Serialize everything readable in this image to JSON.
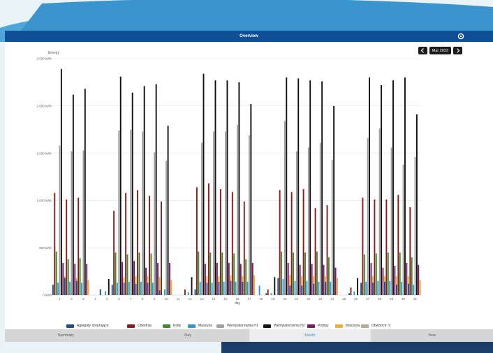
{
  "window": {
    "title": "Overview"
  },
  "nav": {
    "period": "Mar 2023"
  },
  "chart_data": {
    "type": "bar",
    "ylabel": "Energy",
    "xlabel": "day",
    "ylim": [
      0,
      2500
    ],
    "yticks": [
      0,
      500,
      1000,
      1500,
      2000,
      2500
    ],
    "ytick_labels": [
      "0 kWh",
      "500 kWh",
      "1,000 kWh",
      "1,500 kWh",
      "2,000 kWh",
      "2,500 kWh"
    ],
    "categories": [
      "1",
      "2",
      "3",
      "4",
      "5",
      "6",
      "7",
      "8",
      "9",
      "10",
      "11",
      "12",
      "13",
      "14",
      "15",
      "16",
      "17",
      "18",
      "19",
      "20",
      "21",
      "22",
      "23",
      "24",
      "25",
      "26",
      "27",
      "28",
      "29",
      "30",
      "31"
    ],
    "series": [
      {
        "name": "Agregaty sprężające",
        "color": "#1f4f86",
        "values": [
          110,
          180,
          150,
          0,
          60,
          110,
          130,
          120,
          130,
          50,
          0,
          0,
          60,
          130,
          140,
          150,
          140,
          0,
          20,
          180,
          100,
          100,
          120,
          140,
          0,
          20,
          130,
          130,
          140,
          110,
          120
        ]
      },
      {
        "name": "Chłodnia",
        "color": "#8b1a1a",
        "values": [
          1080,
          1010,
          1030,
          0,
          0,
          890,
          1080,
          1110,
          1050,
          990,
          0,
          60,
          1140,
          1180,
          1120,
          1090,
          990,
          0,
          60,
          1110,
          1090,
          1120,
          920,
          950,
          0,
          80,
          1030,
          1010,
          1010,
          1060,
          930
        ]
      },
      {
        "name": "Kotły",
        "color": "#3f8a2e",
        "values": [
          460,
          380,
          390,
          0,
          0,
          450,
          430,
          450,
          440,
          0,
          0,
          0,
          460,
          450,
          450,
          440,
          380,
          0,
          0,
          460,
          450,
          450,
          460,
          400,
          0,
          0,
          430,
          440,
          450,
          450,
          400
        ]
      },
      {
        "name": "Maszyna",
        "color": "#2c9ad6",
        "values": [
          130,
          140,
          130,
          0,
          40,
          130,
          140,
          140,
          130,
          60,
          0,
          30,
          140,
          130,
          140,
          140,
          140,
          100,
          20,
          170,
          150,
          150,
          140,
          140,
          0,
          40,
          140,
          150,
          150,
          140,
          110
        ]
      },
      {
        "name": "Wentylatorownia H1",
        "color": "#a0a0a0",
        "values": [
          1580,
          1520,
          1530,
          0,
          0,
          1740,
          1750,
          1730,
          1510,
          1420,
          0,
          0,
          1610,
          1730,
          1730,
          1800,
          1690,
          0,
          0,
          1840,
          1520,
          1560,
          1610,
          1430,
          0,
          0,
          1660,
          1760,
          1560,
          1380,
          1460
        ]
      },
      {
        "name": "Wentylatorownia H2",
        "color": "#111111",
        "values": [
          2390,
          2120,
          2180,
          0,
          170,
          2310,
          2140,
          2210,
          2230,
          1790,
          0,
          190,
          2340,
          2270,
          2270,
          2250,
          2020,
          0,
          190,
          2300,
          2290,
          2270,
          2260,
          2000,
          0,
          180,
          2300,
          2220,
          2270,
          2300,
          1910
        ]
      },
      {
        "name": "Pompy",
        "color": "#7a1a66",
        "values": [
          340,
          330,
          330,
          0,
          0,
          350,
          360,
          290,
          340,
          340,
          0,
          0,
          330,
          340,
          340,
          330,
          340,
          0,
          0,
          340,
          320,
          330,
          320,
          290,
          0,
          0,
          340,
          290,
          310,
          340,
          320
        ]
      },
      {
        "name": "Maszyna",
        "color": "#f0b030",
        "values": [
          200,
          180,
          160,
          0,
          0,
          190,
          200,
          200,
          190,
          160,
          0,
          0,
          200,
          200,
          210,
          200,
          210,
          0,
          0,
          210,
          200,
          200,
          200,
          180,
          0,
          0,
          200,
          200,
          200,
          200,
          160
        ]
      },
      {
        "name": "Obwód nr. 9",
        "color": "#b5ab8e",
        "values": [
          0,
          0,
          0,
          0,
          0,
          0,
          0,
          0,
          0,
          0,
          0,
          0,
          0,
          0,
          0,
          0,
          0,
          0,
          0,
          0,
          0,
          0,
          0,
          0,
          0,
          0,
          0,
          0,
          0,
          0,
          0
        ]
      }
    ]
  },
  "tabs": [
    {
      "label": "Summary",
      "active": false
    },
    {
      "label": "Day",
      "active": false
    },
    {
      "label": "Month",
      "active": true
    },
    {
      "label": "Year",
      "active": false
    }
  ]
}
